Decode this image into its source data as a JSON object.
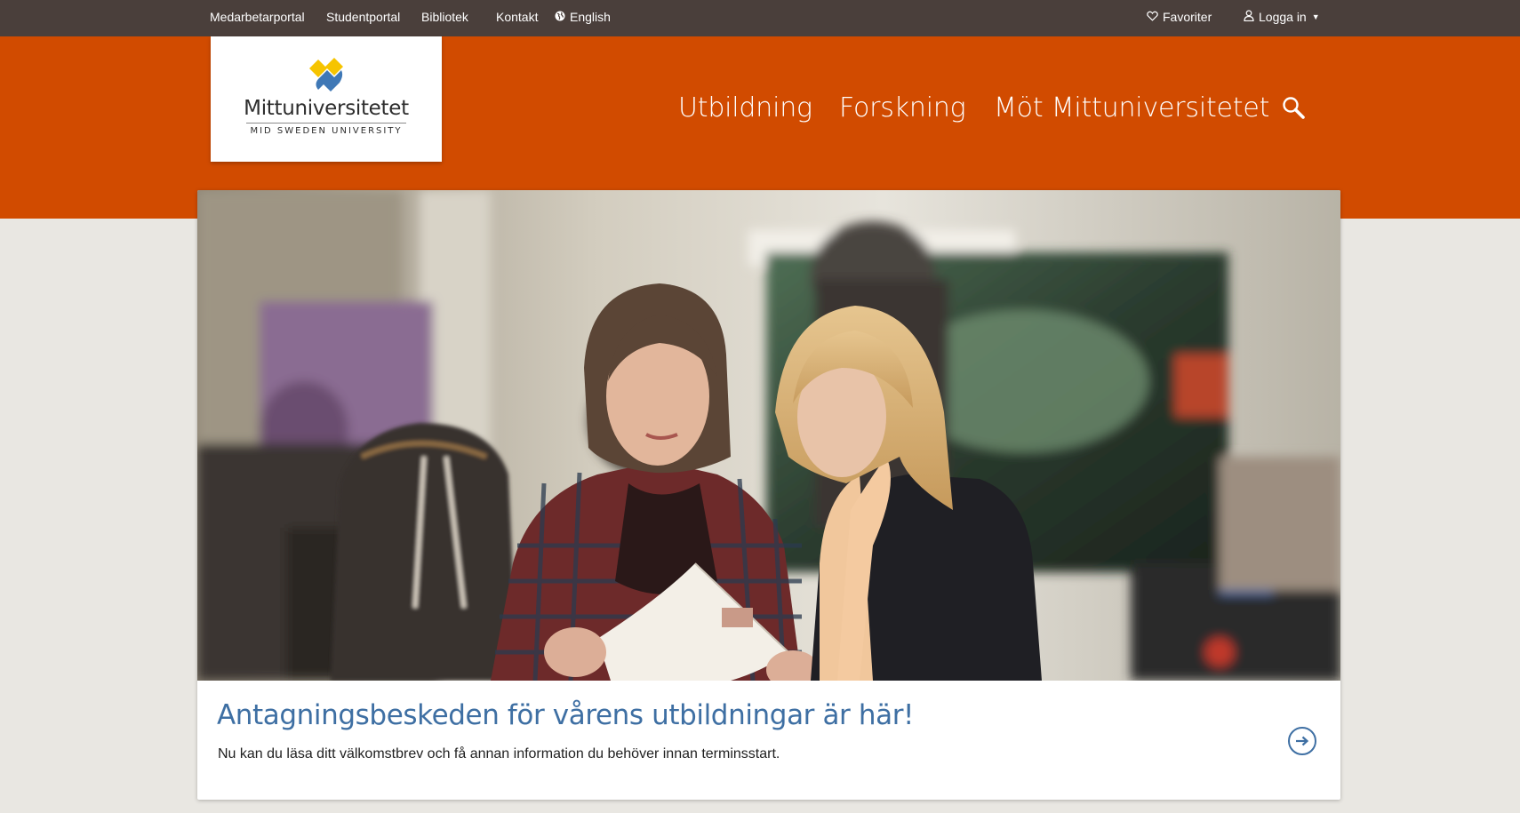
{
  "topbar": {
    "links": {
      "medarbetarportal": "Medarbetarportal",
      "studentportal": "Studentportal",
      "bibliotek": "Bibliotek",
      "kontakt": "Kontakt",
      "english": "English"
    },
    "favorites": "Favoriter",
    "login": "Logga in",
    "login_caret": "▼"
  },
  "logo": {
    "name": "Mittuniversitetet",
    "subtitle": "MID SWEDEN UNIVERSITY"
  },
  "nav": {
    "items": [
      "Utbildning",
      "Forskning",
      "Möt Mittuniversitetet"
    ]
  },
  "hero": {
    "title": "Antagningsbeskeden för vårens utbildningar är här!",
    "description": "Nu kan du läsa ditt välkomstbrev och få annan information du behöver innan terminsstart."
  },
  "colors": {
    "topbar_bg": "#4a3f3b",
    "header_orange": "#d14b00",
    "page_bg": "#e9e7e2",
    "link_blue": "#3e6fa3",
    "logo_yellow": "#f6c400",
    "logo_blue": "#3f78b6"
  },
  "icons": {
    "english": "globe-icon",
    "favorites": "heart-icon",
    "login": "user-icon",
    "search": "search-icon",
    "arrow": "arrow-right-circle-icon"
  }
}
